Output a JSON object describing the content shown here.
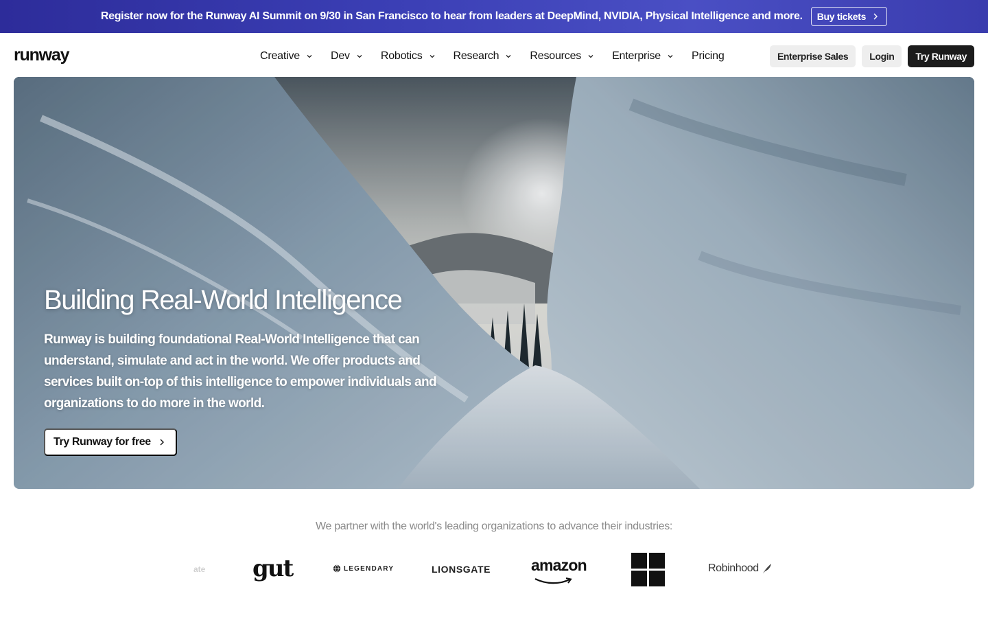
{
  "banner": {
    "text": "Register now for the Runway AI Summit on 9/30 in San Francisco to hear from leaders at DeepMind, NVIDIA, Physical Intelligence and more.",
    "button_label": "Buy tickets"
  },
  "nav": {
    "logo": "runway",
    "menu": [
      {
        "label": "Creative",
        "has_dropdown": true
      },
      {
        "label": "Dev",
        "has_dropdown": true
      },
      {
        "label": "Robotics",
        "has_dropdown": true
      },
      {
        "label": "Research",
        "has_dropdown": true
      },
      {
        "label": "Resources",
        "has_dropdown": true
      },
      {
        "label": "Enterprise",
        "has_dropdown": true
      },
      {
        "label": "Pricing",
        "has_dropdown": false
      }
    ],
    "actions": {
      "enterprise_sales": "Enterprise Sales",
      "login": "Login",
      "try_runway": "Try Runway"
    }
  },
  "hero": {
    "title": "Building Real-World Intelligence",
    "description": "Runway is building foundational Real-World Intelligence that can understand, simulate and act in the world. We offer products and services built on-top of this intelligence to empower individuals and organizations to do more in the world.",
    "cta_label": "Try Runway for free"
  },
  "partners": {
    "heading": "We partner with the world's leading organizations to advance their industries:",
    "logos": {
      "faded": "ate",
      "gut": "gut",
      "legendary": "LEGENDARY",
      "lionsgate": "LIONSGATE",
      "amazon": "amazon",
      "windows": "windows-logo",
      "robinhood": "Robinhood"
    }
  },
  "colors": {
    "banner_start": "#2d2c9a",
    "banner_end": "#4a4fc4",
    "dark_button": "#1c1c1c",
    "light_button": "#eeeeee"
  },
  "icons": [
    "chevron-right-icon",
    "chevron-down-icon",
    "robinhood-feather-icon",
    "legendary-globe-icon"
  ]
}
